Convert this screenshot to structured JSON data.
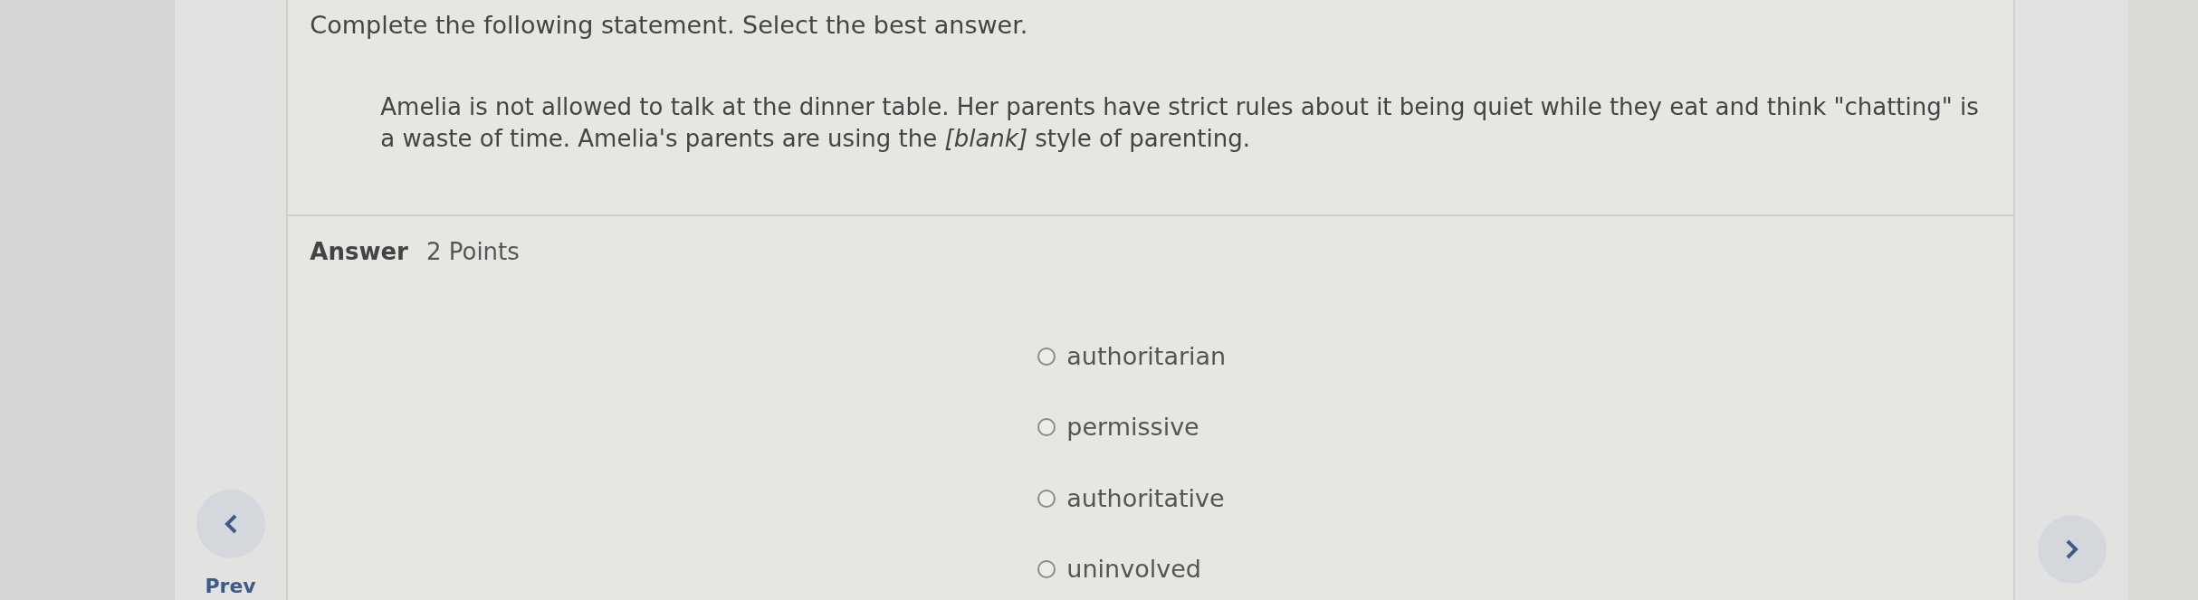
{
  "instruction": "Complete the following statement. Select the best answer.",
  "statement": "Amelia is not allowed to talk at the dinner table. Her parents have strict rules about it being quiet while they eat and think \"chatting\" is a waste of time. Amelia's parents are using the *[blank]* style of parenting.",
  "answer": {
    "label": "Answer",
    "points": "2 Points"
  },
  "options": [
    {
      "label": "authoritarian",
      "selected": false
    },
    {
      "label": "permissive",
      "selected": false
    },
    {
      "label": "authoritative",
      "selected": false
    },
    {
      "label": "uninvolved",
      "selected": false
    }
  ],
  "nav": {
    "prev": "Prev"
  }
}
